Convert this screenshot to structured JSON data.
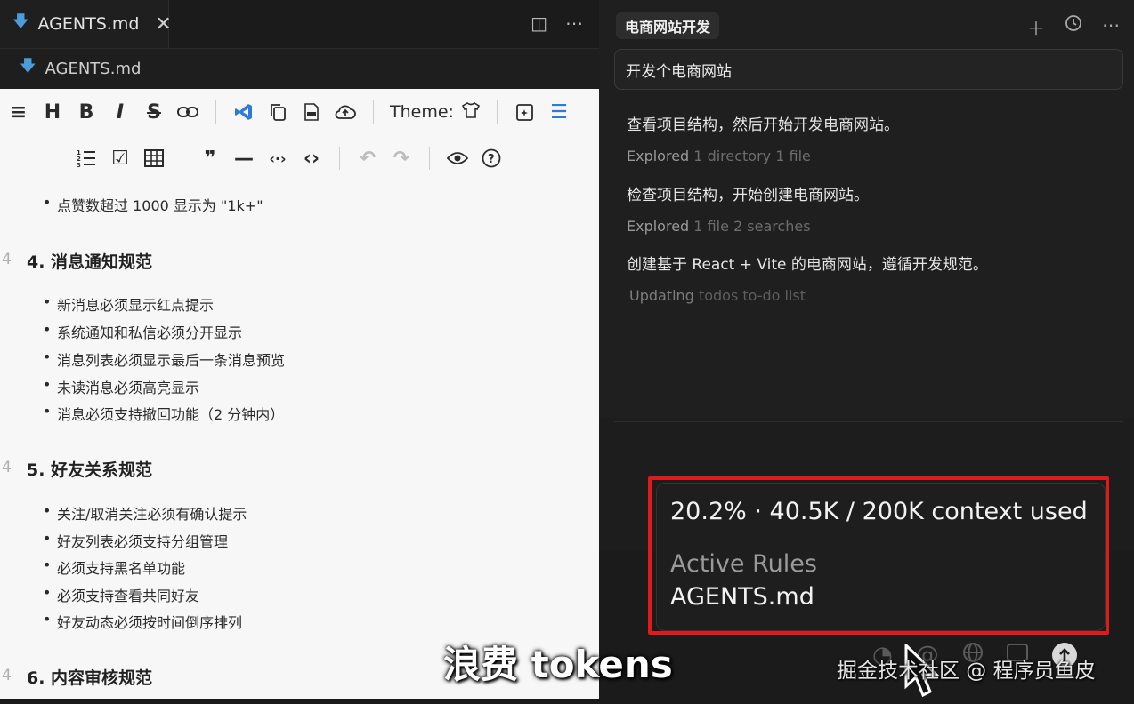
{
  "editor": {
    "tab_label": "AGENTS.md",
    "tab_close": "✕",
    "breadcrumb": "AGENTS.md",
    "toolbar_theme_label": "Theme:"
  },
  "document": {
    "partial_bullet": "点赞数超过 1000 显示为 \"1k+\"",
    "sections": [
      {
        "num": "4",
        "title": "4. 消息通知规范",
        "items": [
          "新消息必须显示红点提示",
          "系统通知和私信必须分开显示",
          "消息列表必须显示最后一条消息预览",
          "未读消息必须高亮显示",
          "消息必须支持撤回功能（2 分钟内）"
        ]
      },
      {
        "num": "4",
        "title": "5. 好友关系规范",
        "items": [
          "关注/取消关注必须有确认提示",
          "好友列表必须支持分组管理",
          "必须支持黑名单功能",
          "必须支持查看共同好友",
          "好友动态必须按时间倒序排列"
        ]
      },
      {
        "num": "4",
        "title": "6. 内容审核规范",
        "items": []
      }
    ]
  },
  "chat": {
    "title": "电商网站开发",
    "prompt": "开发个电商网站",
    "messages": [
      {
        "type": "text",
        "text": "查看项目结构，然后开始开发电商网站。"
      },
      {
        "type": "explored",
        "lead": "Explored",
        "rest": "1 directory 1 file"
      },
      {
        "type": "text",
        "text": "检查项目结构，开始创建电商网站。"
      },
      {
        "type": "explored",
        "lead": "Explored",
        "rest": "1 file 2 searches"
      },
      {
        "type": "text",
        "text": "创建基于 React + Vite 的电商网站，遵循开发规范。"
      },
      {
        "type": "explored",
        "lead": "Updating",
        "rest": "todos to-do list"
      }
    ]
  },
  "context_tooltip": {
    "usage": "20.2% · 40.5K / 200K context used",
    "rules_label": "Active Rules",
    "rules_value": "AGENTS.md"
  },
  "overlay": {
    "caption": "浪费 tokens",
    "watermark": "掘金技术社区 @ 程序员鱼皮"
  },
  "colors": {
    "highlight_red": "#e0191c",
    "markdown_blue": "#4b9cd8"
  }
}
